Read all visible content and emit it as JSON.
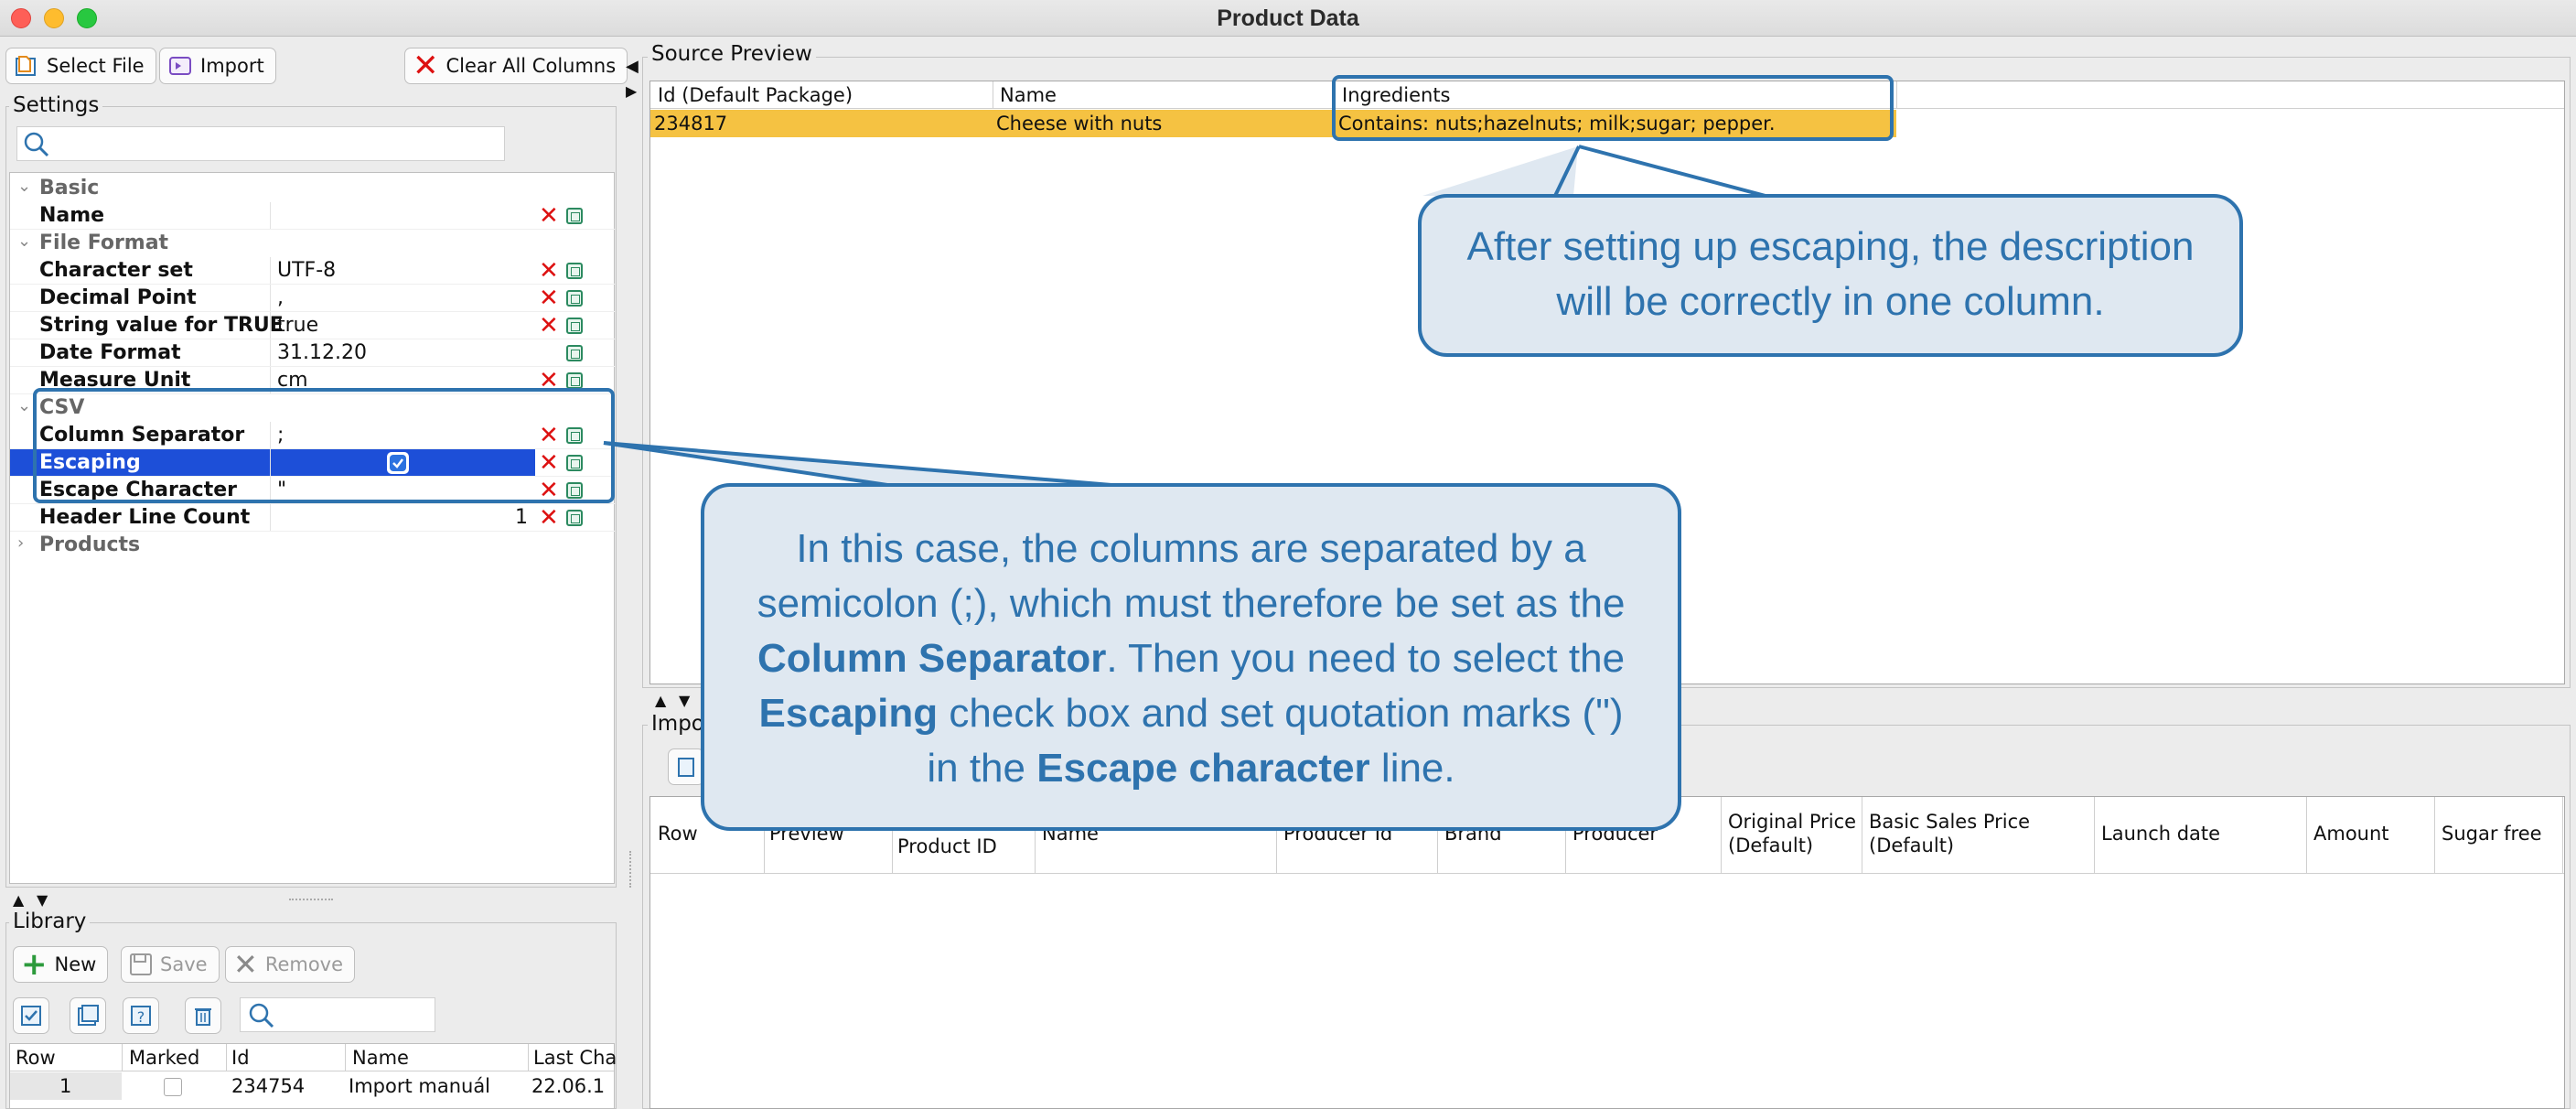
{
  "window": {
    "title": "Product Data"
  },
  "toolbar": {
    "select_file": "Select File",
    "import": "Import",
    "clear_all": "Clear All Columns"
  },
  "settings": {
    "label": "Settings",
    "rows": [
      {
        "kind": "category",
        "label": "Basic"
      },
      {
        "kind": "prop",
        "label": "Name",
        "value": ""
      },
      {
        "kind": "category",
        "label": "File Format"
      },
      {
        "kind": "prop",
        "label": "Character set",
        "value": "UTF-8"
      },
      {
        "kind": "prop",
        "label": "Decimal Point",
        "value": ","
      },
      {
        "kind": "prop",
        "label": "String value for TRUE",
        "value": "true"
      },
      {
        "kind": "prop",
        "label": "Date Format",
        "value": "31.12.20"
      },
      {
        "kind": "prop",
        "label": "Measure Unit",
        "value": "cm"
      },
      {
        "kind": "category",
        "label": "CSV"
      },
      {
        "kind": "prop",
        "label": "Column Separator",
        "value": ";"
      },
      {
        "kind": "prop",
        "label": "Escaping",
        "value": "",
        "checked": true
      },
      {
        "kind": "prop",
        "label": "Escape Character",
        "value": "\""
      },
      {
        "kind": "prop",
        "label": "Header Line Count",
        "value": "1"
      },
      {
        "kind": "category",
        "label": "Products"
      }
    ]
  },
  "library": {
    "label": "Library",
    "new": "New",
    "save": "Save",
    "remove": "Remove",
    "columns": [
      "Row",
      "Marked",
      "Id",
      "Name",
      "Last Cha"
    ],
    "rows": [
      {
        "row": "1",
        "marked": "",
        "id": "234754",
        "name": "Import manuál",
        "last": "22.06.1"
      }
    ]
  },
  "source_preview": {
    "label": "Source Preview",
    "columns": [
      "Id (Default Package)",
      "Name",
      "Ingredients"
    ],
    "rows": [
      {
        "id": "234817",
        "name": "Cheese with nuts",
        "ingredients": "Contains: nuts;hazelnuts; milk;sugar; pepper."
      }
    ]
  },
  "import_preview": {
    "label": "Impo",
    "columns": [
      "Row",
      "Preview",
      "Product ID",
      "Name",
      "Producer Id",
      "Brand",
      "Producer",
      "Original Price (Default)",
      "Basic Sales Price (Default)",
      "Launch date",
      "Amount",
      "Sugar free"
    ]
  },
  "callouts": {
    "top": "After setting up escaping, the description will be correctly in one column.",
    "main": {
      "t1": "In this case, the columns are separated by a semicolon (;), which must therefore be set as the ",
      "b1": "Column Separator",
      "t2": ". Then you need to select the ",
      "b2": "Escaping",
      "t3": " check box and set quotation marks (\") in the ",
      "b3": "Escape character",
      "t4": " line."
    }
  },
  "colors": {
    "accent": "#2e73ae",
    "row_highlight": "#f5c242",
    "selection": "#1d4fd8"
  }
}
